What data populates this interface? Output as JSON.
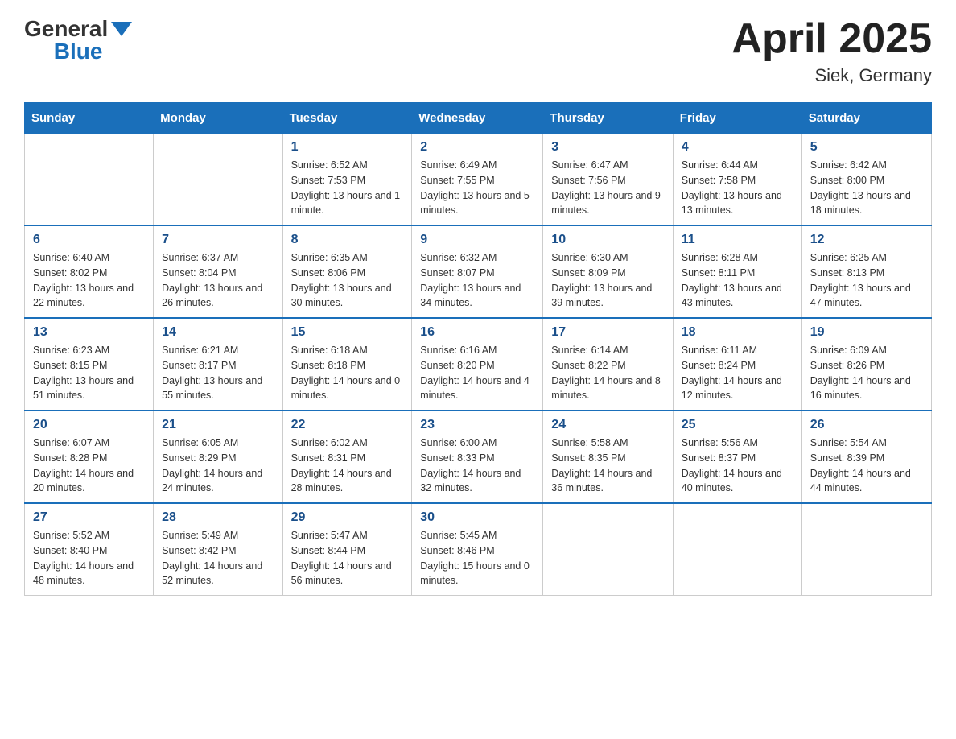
{
  "logo": {
    "text_general": "General",
    "text_blue": "Blue"
  },
  "title": "April 2025",
  "subtitle": "Siek, Germany",
  "days_of_week": [
    "Sunday",
    "Monday",
    "Tuesday",
    "Wednesday",
    "Thursday",
    "Friday",
    "Saturday"
  ],
  "weeks": [
    [
      {
        "day": "",
        "info": ""
      },
      {
        "day": "",
        "info": ""
      },
      {
        "day": "1",
        "info": "Sunrise: 6:52 AM\nSunset: 7:53 PM\nDaylight: 13 hours and 1 minute."
      },
      {
        "day": "2",
        "info": "Sunrise: 6:49 AM\nSunset: 7:55 PM\nDaylight: 13 hours and 5 minutes."
      },
      {
        "day": "3",
        "info": "Sunrise: 6:47 AM\nSunset: 7:56 PM\nDaylight: 13 hours and 9 minutes."
      },
      {
        "day": "4",
        "info": "Sunrise: 6:44 AM\nSunset: 7:58 PM\nDaylight: 13 hours and 13 minutes."
      },
      {
        "day": "5",
        "info": "Sunrise: 6:42 AM\nSunset: 8:00 PM\nDaylight: 13 hours and 18 minutes."
      }
    ],
    [
      {
        "day": "6",
        "info": "Sunrise: 6:40 AM\nSunset: 8:02 PM\nDaylight: 13 hours and 22 minutes."
      },
      {
        "day": "7",
        "info": "Sunrise: 6:37 AM\nSunset: 8:04 PM\nDaylight: 13 hours and 26 minutes."
      },
      {
        "day": "8",
        "info": "Sunrise: 6:35 AM\nSunset: 8:06 PM\nDaylight: 13 hours and 30 minutes."
      },
      {
        "day": "9",
        "info": "Sunrise: 6:32 AM\nSunset: 8:07 PM\nDaylight: 13 hours and 34 minutes."
      },
      {
        "day": "10",
        "info": "Sunrise: 6:30 AM\nSunset: 8:09 PM\nDaylight: 13 hours and 39 minutes."
      },
      {
        "day": "11",
        "info": "Sunrise: 6:28 AM\nSunset: 8:11 PM\nDaylight: 13 hours and 43 minutes."
      },
      {
        "day": "12",
        "info": "Sunrise: 6:25 AM\nSunset: 8:13 PM\nDaylight: 13 hours and 47 minutes."
      }
    ],
    [
      {
        "day": "13",
        "info": "Sunrise: 6:23 AM\nSunset: 8:15 PM\nDaylight: 13 hours and 51 minutes."
      },
      {
        "day": "14",
        "info": "Sunrise: 6:21 AM\nSunset: 8:17 PM\nDaylight: 13 hours and 55 minutes."
      },
      {
        "day": "15",
        "info": "Sunrise: 6:18 AM\nSunset: 8:18 PM\nDaylight: 14 hours and 0 minutes."
      },
      {
        "day": "16",
        "info": "Sunrise: 6:16 AM\nSunset: 8:20 PM\nDaylight: 14 hours and 4 minutes."
      },
      {
        "day": "17",
        "info": "Sunrise: 6:14 AM\nSunset: 8:22 PM\nDaylight: 14 hours and 8 minutes."
      },
      {
        "day": "18",
        "info": "Sunrise: 6:11 AM\nSunset: 8:24 PM\nDaylight: 14 hours and 12 minutes."
      },
      {
        "day": "19",
        "info": "Sunrise: 6:09 AM\nSunset: 8:26 PM\nDaylight: 14 hours and 16 minutes."
      }
    ],
    [
      {
        "day": "20",
        "info": "Sunrise: 6:07 AM\nSunset: 8:28 PM\nDaylight: 14 hours and 20 minutes."
      },
      {
        "day": "21",
        "info": "Sunrise: 6:05 AM\nSunset: 8:29 PM\nDaylight: 14 hours and 24 minutes."
      },
      {
        "day": "22",
        "info": "Sunrise: 6:02 AM\nSunset: 8:31 PM\nDaylight: 14 hours and 28 minutes."
      },
      {
        "day": "23",
        "info": "Sunrise: 6:00 AM\nSunset: 8:33 PM\nDaylight: 14 hours and 32 minutes."
      },
      {
        "day": "24",
        "info": "Sunrise: 5:58 AM\nSunset: 8:35 PM\nDaylight: 14 hours and 36 minutes."
      },
      {
        "day": "25",
        "info": "Sunrise: 5:56 AM\nSunset: 8:37 PM\nDaylight: 14 hours and 40 minutes."
      },
      {
        "day": "26",
        "info": "Sunrise: 5:54 AM\nSunset: 8:39 PM\nDaylight: 14 hours and 44 minutes."
      }
    ],
    [
      {
        "day": "27",
        "info": "Sunrise: 5:52 AM\nSunset: 8:40 PM\nDaylight: 14 hours and 48 minutes."
      },
      {
        "day": "28",
        "info": "Sunrise: 5:49 AM\nSunset: 8:42 PM\nDaylight: 14 hours and 52 minutes."
      },
      {
        "day": "29",
        "info": "Sunrise: 5:47 AM\nSunset: 8:44 PM\nDaylight: 14 hours and 56 minutes."
      },
      {
        "day": "30",
        "info": "Sunrise: 5:45 AM\nSunset: 8:46 PM\nDaylight: 15 hours and 0 minutes."
      },
      {
        "day": "",
        "info": ""
      },
      {
        "day": "",
        "info": ""
      },
      {
        "day": "",
        "info": ""
      }
    ]
  ]
}
